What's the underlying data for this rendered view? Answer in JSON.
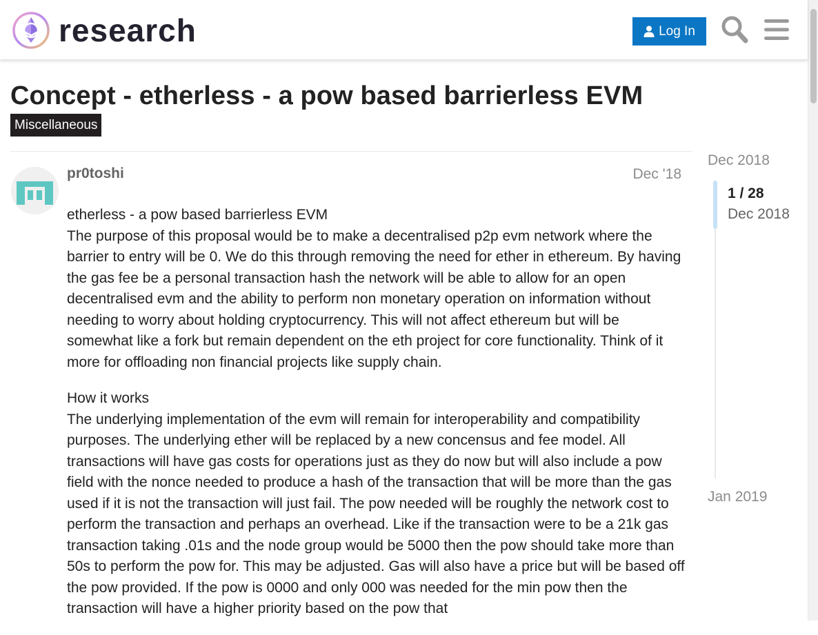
{
  "header": {
    "site_name": "research",
    "login_label": "Log In",
    "icons": [
      "logo-icon",
      "user-icon",
      "search-icon",
      "hamburger-menu-icon"
    ]
  },
  "topic": {
    "title": "Concept - etherless - a pow based barrierless EVM",
    "category": "Miscellaneous",
    "category_color": "#231f20"
  },
  "post": {
    "username": "pr0toshi",
    "date": "Dec '18",
    "avatar_color": "#5ec7c2",
    "paragraphs": [
      "etherless - a pow based barrierless EVM",
      "The purpose of this proposal would be to make a decentralised p2p evm network where the barrier to entry will be 0. We do this through removing the need for ether in ethereum. By having the gas fee be a personal transaction hash the network will be able to allow for an open decentralised evm and the ability to perform non monetary operation on information without needing to worry about holding cryptocurrency. This will not affect ethereum but will be somewhat like a fork but remain dependent on the eth project for core functionality. Think of it more for offloading non financial projects like supply chain.",
      "How it works",
      "The underlying implementation of the evm will remain for interoperability and compatibility purposes. The underlying ether will be replaced by a new concensus and fee model. All transactions will have gas costs for operations just as they do now but will also include a pow field with the nonce needed to produce a hash of the transaction that will be more than the gas used if it is not the transaction will just fail. The pow needed will be roughly the network cost to perform the transaction and perhaps an overhead. Like if the transaction were to be a 21k gas transaction taking .01s and the node group would be 5000 then the pow should take more than 50s to perform the pow for. This may be adjusted. Gas will also have a price but will be based off the pow provided. If the pow is 0000 and only 000 was needed for the min pow then the transaction will have a higher priority based on the pow that"
    ]
  },
  "timeline": {
    "start_label": "Dec 2018",
    "position": "1 / 28",
    "current_date": "Dec 2018",
    "end_label": "Jan 2019"
  },
  "colors": {
    "accent": "#0a76c4",
    "text": "#222222",
    "muted": "#8c8c8c",
    "timeline_handle": "#c6e2f6"
  }
}
